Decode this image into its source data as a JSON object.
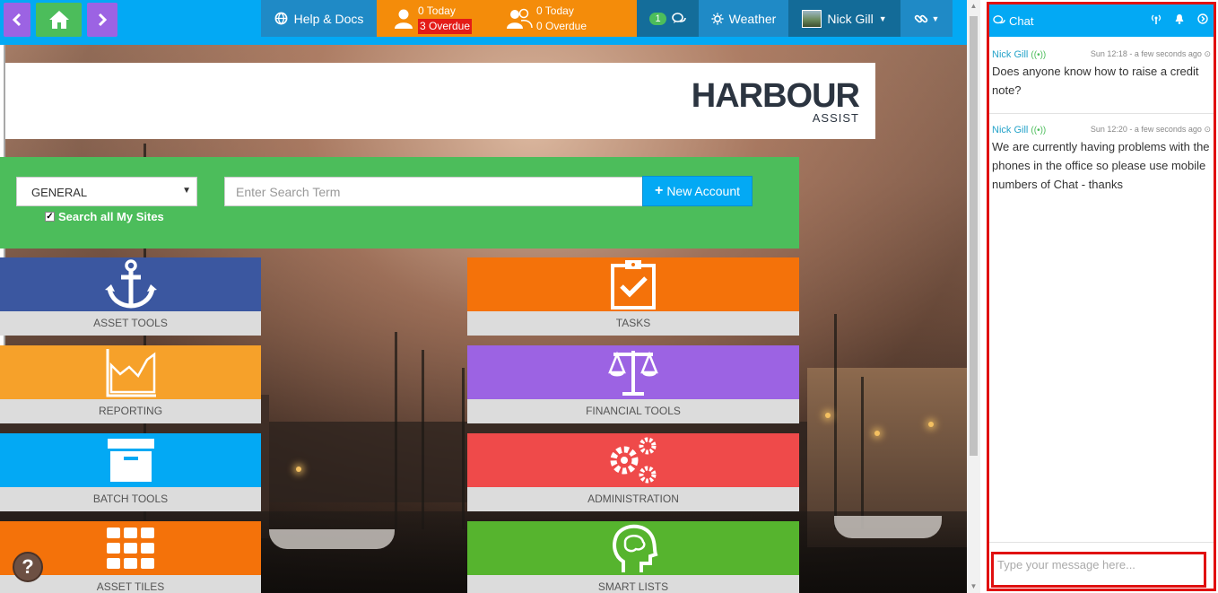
{
  "topbar": {
    "help_label": "Help & Docs",
    "my_tasks": {
      "today": "0 Today",
      "overdue": "3 Overdue"
    },
    "team_tasks": {
      "today": "0 Today",
      "overdue": "0 Overdue"
    },
    "chat_count": "1",
    "weather_label": "Weather",
    "user_name": "Nick Gill"
  },
  "logo": {
    "main": "HARBOUR",
    "sub": "ASSIST"
  },
  "search": {
    "category": "GENERAL",
    "search_all_label": "Search all My Sites",
    "search_all_checked": true,
    "placeholder": "Enter Search Term",
    "new_account_label": "New Account"
  },
  "tiles": [
    {
      "label": "ASSET TOOLS",
      "color": "#3b57a0",
      "icon": "anchor-icon"
    },
    {
      "label": "TASKS",
      "color": "#f4720a",
      "icon": "clipboard-check-icon"
    },
    {
      "label": "REPORTING",
      "color": "#f6a12a",
      "icon": "area-chart-icon"
    },
    {
      "label": "FINANCIAL TOOLS",
      "color": "#9c63e3",
      "icon": "balance-scale-icon"
    },
    {
      "label": "BATCH TOOLS",
      "color": "#03a9f4",
      "icon": "archive-box-icon"
    },
    {
      "label": "ADMINISTRATION",
      "color": "#ef4a4a",
      "icon": "gears-icon"
    },
    {
      "label": "ASSET TILES",
      "color": "#f4720a",
      "icon": "grid-tiles-icon"
    },
    {
      "label": "SMART LISTS",
      "color": "#56b42e",
      "icon": "brain-head-icon"
    }
  ],
  "chat": {
    "title": "Chat",
    "messages": [
      {
        "author": "Nick Gill",
        "time": "Sun 12:18 - a few seconds ago",
        "text": "Does anyone know how to raise a credit note?"
      },
      {
        "author": "Nick Gill",
        "time": "Sun 12:20 - a few seconds ago",
        "text": "We are currently having problems with the phones in the office so please use mobile numbers of Chat - thanks"
      }
    ],
    "input_placeholder": "Type your message here..."
  },
  "help_bubble": "?"
}
